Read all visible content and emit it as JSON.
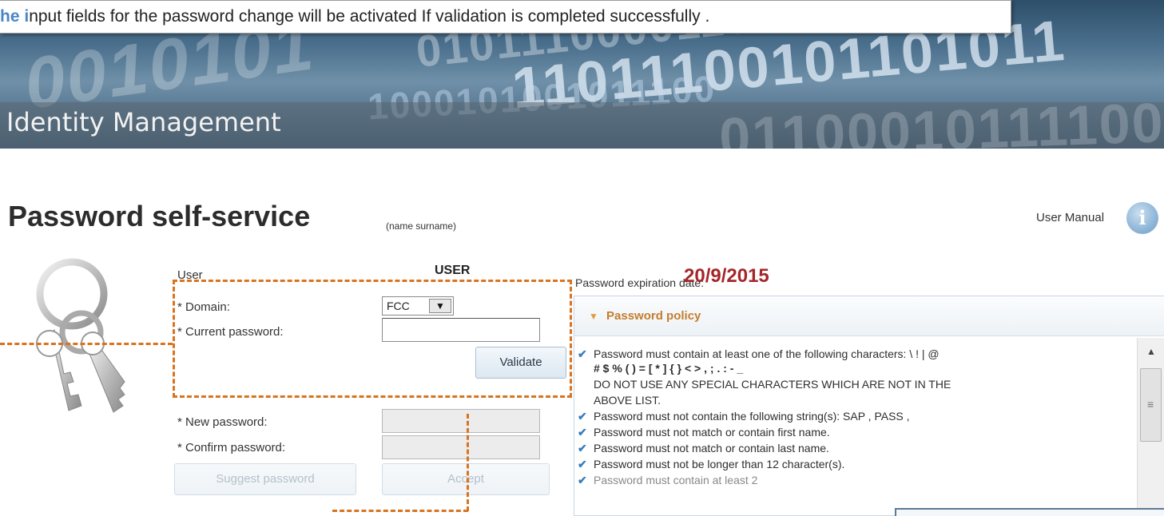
{
  "callout": {
    "accent_text": "he i",
    "rest_text": "nput fields for the password change will be activated If validation  is completed successfully ."
  },
  "banner": {
    "app_title": "Identity Management",
    "binary_1": "0101110000110",
    "binary_2": "11011100101101011",
    "binary_3": "1000101001011100",
    "binary_4": "011000101111001011000",
    "binary_5": "0010101"
  },
  "header": {
    "page_title": "Password self-service",
    "name_hint": "(name surname)",
    "user_manual_label": "User Manual",
    "info_icon_glyph": "i"
  },
  "form": {
    "user_label": "User",
    "user_value": "USER",
    "domain_label": "* Domain:",
    "domain_value": "FCC",
    "domain_arrow": "▼",
    "current_password_label": "* Current password:",
    "current_password_value": "",
    "validate_label": "Validate",
    "new_password_label": "* New password:",
    "new_password_value": "",
    "confirm_password_label": "* Confirm password:",
    "confirm_password_value": "",
    "suggest_label": "Suggest password",
    "accept_label": "Accept"
  },
  "expiration": {
    "label": "Password expiration date:",
    "date": "20/9/2015"
  },
  "policy": {
    "title": "Password policy",
    "rules": [
      "Password must contain at least one of the following characters: \\ ! | @",
      "# $ % ( ) = [ * ] { } < > , ; . : - _",
      "DO NOT USE ANY SPECIAL CHARACTERS WHICH ARE NOT IN THE",
      "ABOVE LIST.",
      "Password must not contain the following string(s): SAP , PASS ,",
      "Password must not match or contain first name.",
      "Password must not match or contain last name.",
      "Password must not be longer than 12 character(s).",
      "Password must contain at least 2"
    ]
  },
  "colors": {
    "accent_blue": "#4a86c5",
    "highlight_orange": "#d8731f",
    "expiration_red": "#a5262a",
    "policy_title": "#c57d2e"
  },
  "icons": {
    "keys": "keys-icon",
    "info": "info-icon",
    "check": "check-icon",
    "dropdown": "chevron-down-icon",
    "collapse": "triangle-down-icon",
    "scroll_up": "scroll-up-icon",
    "grip": "grip-icon"
  }
}
